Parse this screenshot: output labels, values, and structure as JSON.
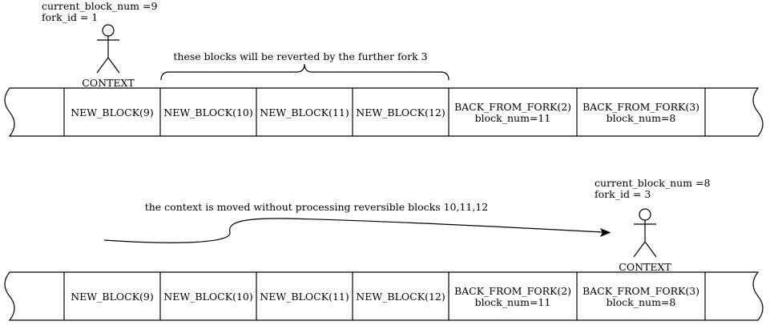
{
  "diagram": {
    "top_context": {
      "label": "CONTEXT",
      "info_line1": "current_block_num =9",
      "info_line2": "fork_id = 1"
    },
    "brace_note": "these blocks will be reverted by the further fork 3",
    "top_blocks": [
      {
        "line1": "NEW_BLOCK(9)",
        "line2": ""
      },
      {
        "line1": "NEW_BLOCK(10)",
        "line2": ""
      },
      {
        "line1": "NEW_BLOCK(11)",
        "line2": ""
      },
      {
        "line1": "NEW_BLOCK(12)",
        "line2": ""
      },
      {
        "line1": "BACK_FROM_FORK(2)",
        "line2": "block_num=11"
      },
      {
        "line1": "BACK_FROM_FORK(3)",
        "line2": "block_num=8"
      }
    ],
    "move_note": "the context is moved without processing reversible blocks 10,11,12",
    "bottom_context": {
      "label": "CONTEXT",
      "info_line1": "current_block_num =8",
      "info_line2": "fork_id = 3"
    },
    "bottom_blocks": [
      {
        "line1": "NEW_BLOCK(9)",
        "line2": ""
      },
      {
        "line1": "NEW_BLOCK(10)",
        "line2": ""
      },
      {
        "line1": "NEW_BLOCK(11)",
        "line2": ""
      },
      {
        "line1": "NEW_BLOCK(12)",
        "line2": ""
      },
      {
        "line1": "BACK_FROM_FORK(2)",
        "line2": "block_num=11"
      },
      {
        "line1": "BACK_FROM_FORK(3)",
        "line2": "block_num=8"
      }
    ]
  }
}
